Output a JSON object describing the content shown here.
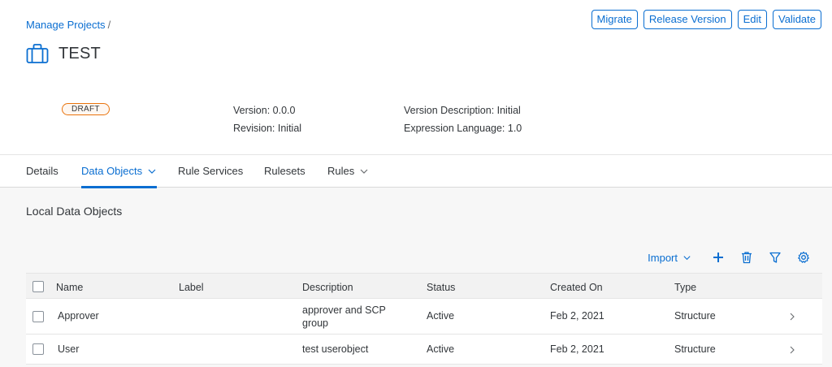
{
  "breadcrumb": {
    "link": "Manage Projects",
    "separator": "/"
  },
  "project": {
    "title": "TEST",
    "icon": "briefcase-icon",
    "status": "DRAFT"
  },
  "actions": {
    "migrate": "Migrate",
    "release": "Release Version",
    "edit": "Edit",
    "validate": "Validate"
  },
  "meta": {
    "version": "Version: 0.0.0",
    "revision": "Revision: Initial",
    "version_description": "Version Description: Initial",
    "expression_language": "Expression Language: 1.0"
  },
  "tabs": [
    {
      "label": "Details"
    },
    {
      "label": "Data Objects"
    },
    {
      "label": "Rule Services"
    },
    {
      "label": "Rulesets"
    },
    {
      "label": "Rules"
    }
  ],
  "section": {
    "title": "Local Data Objects"
  },
  "toolbar": {
    "import": "Import"
  },
  "table": {
    "columns": [
      "Name",
      "Label",
      "Description",
      "Status",
      "Created On",
      "Type"
    ],
    "rows": [
      {
        "name": "Approver",
        "label": "",
        "description_line1": "approver and SCP",
        "description_line2": "group",
        "status": "Active",
        "created_on": "Feb 2, 2021",
        "type": "Structure"
      },
      {
        "name": "User",
        "label": "",
        "description_line1": "test userobject",
        "description_line2": "",
        "status": "Active",
        "created_on": "Feb 2, 2021",
        "type": "Structure"
      }
    ]
  },
  "colors": {
    "accent": "#0a6ed1",
    "draft_border": "#e9730c",
    "text": "#32363a"
  }
}
